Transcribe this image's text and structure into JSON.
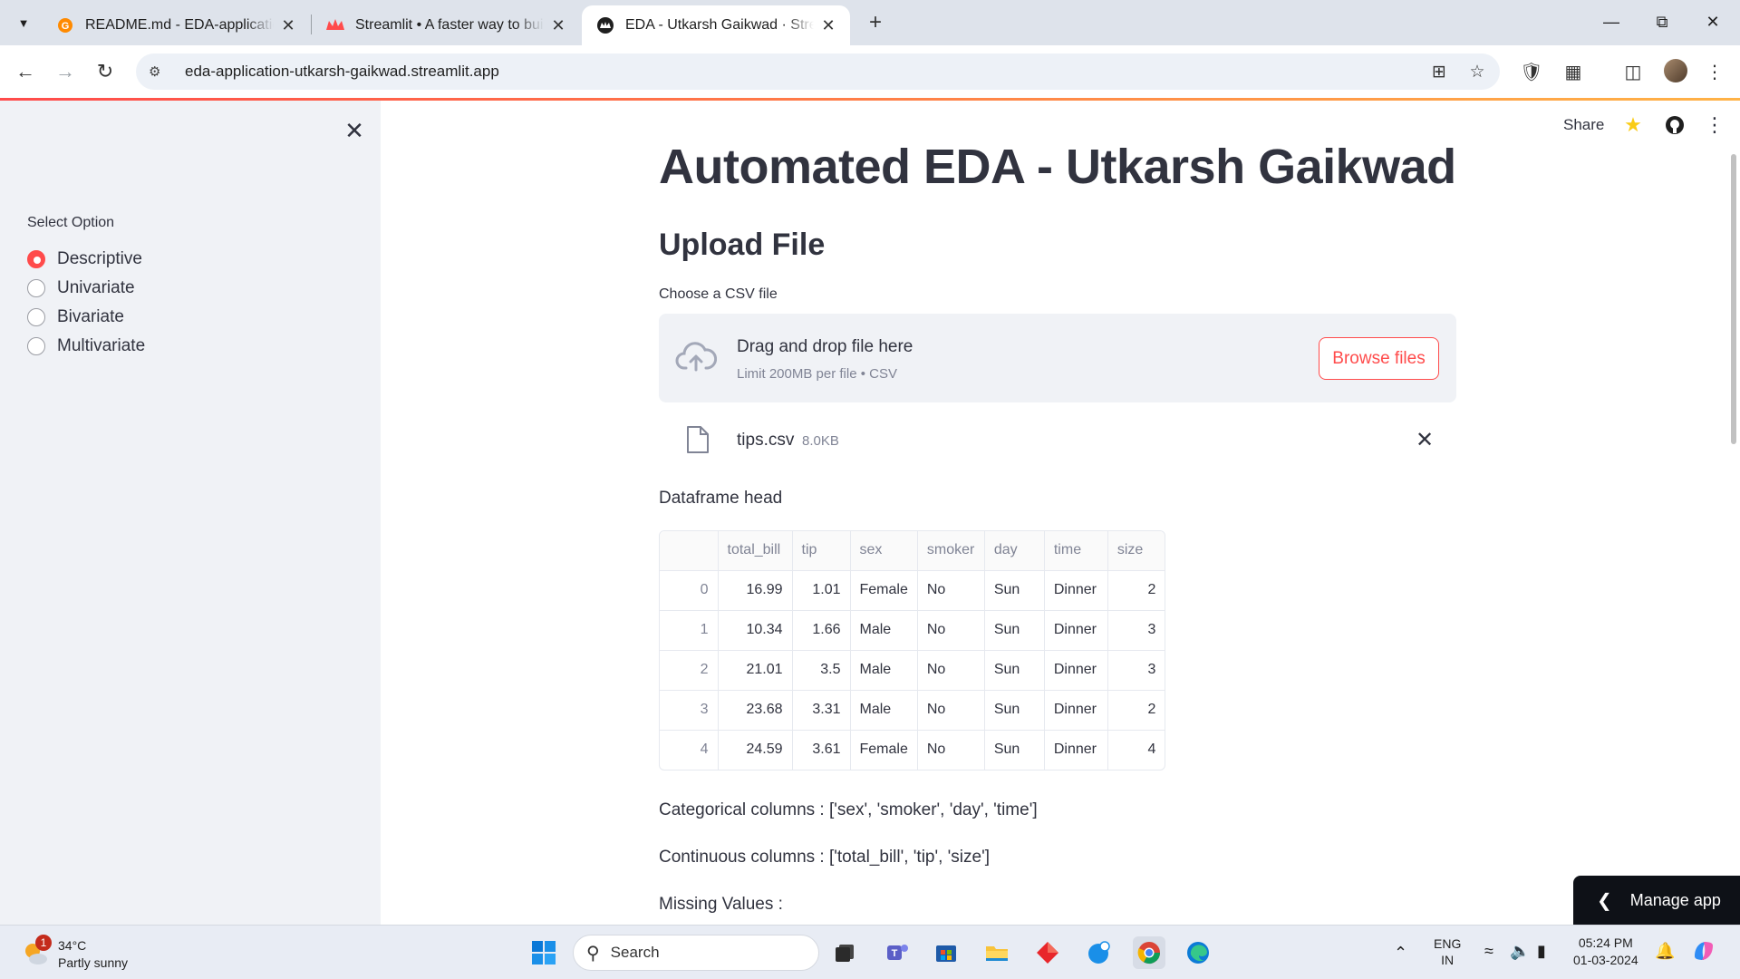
{
  "browser": {
    "tabs": [
      {
        "title": "README.md - EDA-application",
        "favicon": "gitpod-icon"
      },
      {
        "title": "Streamlit • A faster way to build",
        "favicon": "streamlit-crown-icon"
      },
      {
        "title": "EDA - Utkarsh Gaikwad · Streamlit",
        "favicon": "streamlit-crown-icon"
      }
    ],
    "url": "eda-application-utkarsh-gaikwad.streamlit.app"
  },
  "sidebar": {
    "radio_label": "Select Option",
    "options": [
      "Descriptive",
      "Univariate",
      "Bivariate",
      "Multivariate"
    ],
    "selected": "Descriptive"
  },
  "header": {
    "share": "Share"
  },
  "main": {
    "title": "Automated EDA - Utkarsh Gaikwad",
    "subheader": "Upload File",
    "uploader": {
      "label": "Choose a CSV file",
      "drop_text": "Drag and drop file here",
      "limit_text": "Limit 200MB per file • CSV",
      "browse_label": "Browse files"
    },
    "uploaded_file": {
      "name": "tips.csv",
      "size": "8.0KB"
    },
    "dataframe_label": "Dataframe head",
    "dataframe": {
      "columns": [
        "",
        "total_bill",
        "tip",
        "sex",
        "smoker",
        "day",
        "time",
        "size"
      ],
      "rows": [
        [
          "0",
          "16.99",
          "1.01",
          "Female",
          "No",
          "Sun",
          "Dinner",
          "2"
        ],
        [
          "1",
          "10.34",
          "1.66",
          "Male",
          "No",
          "Sun",
          "Dinner",
          "3"
        ],
        [
          "2",
          "21.01",
          "3.5",
          "Male",
          "No",
          "Sun",
          "Dinner",
          "3"
        ],
        [
          "3",
          "23.68",
          "3.31",
          "Male",
          "No",
          "Sun",
          "Dinner",
          "2"
        ],
        [
          "4",
          "24.59",
          "3.61",
          "Female",
          "No",
          "Sun",
          "Dinner",
          "4"
        ]
      ]
    },
    "categorical_text": "Categorical columns : ['sex', 'smoker', 'day', 'time']",
    "continuous_text": "Continuous columns : ['total_bill', 'tip', 'size']",
    "missing_text": "Missing Values :"
  },
  "manage_app": "Manage app",
  "taskbar": {
    "weather_temp": "34°C",
    "weather_cond": "Partly sunny",
    "weather_badge": "1",
    "search_placeholder": "Search",
    "lang_top": "ENG",
    "lang_bottom": "IN",
    "time": "05:24 PM",
    "date": "01-03-2024"
  },
  "colors": {
    "accent": "#ff4b4b",
    "sidebar_bg": "#f0f2f6",
    "text": "#31333f"
  }
}
